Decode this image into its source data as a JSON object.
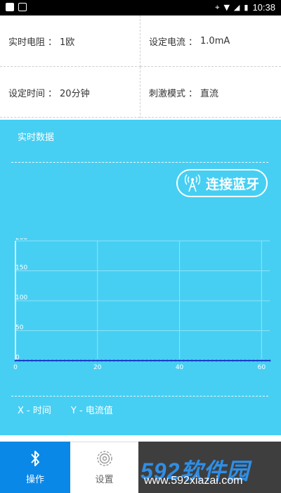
{
  "status_bar": {
    "time": "10:38"
  },
  "params": [
    {
      "label": "实时电阻",
      "separator": "：",
      "value": "1欧"
    },
    {
      "label": "设定电流",
      "separator": "：",
      "value": "1.0mA"
    },
    {
      "label": "设定时间",
      "separator": "：",
      "value": "20分钟"
    },
    {
      "label": "刺激模式",
      "separator": "：",
      "value": "直流"
    }
  ],
  "panel": {
    "title": "实时数据",
    "bluetooth_label": "连接蓝牙",
    "legend_x": "X - 时间",
    "legend_y": "Y - 电流值"
  },
  "chart_data": {
    "type": "line",
    "x_ticks": [
      0,
      20,
      40,
      60
    ],
    "y_ticks": [
      0,
      50,
      100,
      150,
      200
    ],
    "xlim": [
      0,
      62
    ],
    "ylim": [
      0,
      200
    ],
    "grid": true,
    "series": [
      {
        "values": [
          0,
          0,
          0,
          0,
          0,
          0,
          0,
          0,
          0,
          0,
          0,
          0,
          0,
          0,
          0,
          0,
          0,
          0,
          0,
          0,
          0,
          0,
          0,
          0,
          0,
          0,
          0,
          0,
          0,
          0,
          0,
          0,
          0,
          0,
          0,
          0,
          0,
          0,
          0,
          0,
          0,
          0,
          0,
          0,
          0,
          0,
          0,
          0,
          0,
          0,
          0,
          0,
          0,
          0,
          0,
          0,
          0,
          0,
          0,
          0,
          0,
          0,
          0
        ]
      }
    ],
    "colors": {
      "line": "#1a3fc6",
      "axis": "#ffffff",
      "grid": "#8fe3f8"
    }
  },
  "bottom_nav": {
    "tabs": [
      {
        "label": "操作",
        "icon": "bluetooth-icon",
        "active": true
      },
      {
        "label": "设置",
        "icon": "settings-gear-icon",
        "active": false
      }
    ]
  },
  "watermark": {
    "brand": "592软件园",
    "url": "www.592xiazai.com"
  }
}
